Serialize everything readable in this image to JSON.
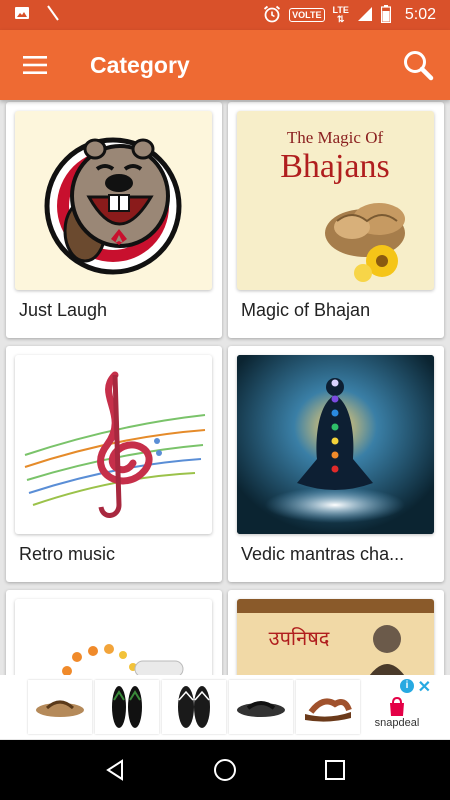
{
  "status_bar": {
    "time": "5:02",
    "volte": "VOLTE",
    "lte": "LTE",
    "icons": [
      "image-icon",
      "signal-slash-icon",
      "alarm-icon",
      "signal-icon",
      "battery-icon"
    ]
  },
  "app_bar": {
    "title": "Category",
    "menu_icon": "hamburger-menu-icon",
    "search_icon": "search-icon",
    "background": "#ee6a33",
    "status_background": "#d9512a"
  },
  "categories": [
    {
      "label": "Just Laugh",
      "image": "laughing-beaver-logo"
    },
    {
      "label": "Magic of Bhajan",
      "image": "magic-of-bhajans-cover",
      "image_text_top": "The Magic Of",
      "image_text_main": "Bhajans"
    },
    {
      "label": "Retro music",
      "image": "treble-clef-staff"
    },
    {
      "label": "Vedic mantras cha...",
      "image": "meditation-chakras"
    },
    {
      "label": "",
      "image": "flowers-scroll"
    },
    {
      "label": "",
      "image": "upanishad-scroll",
      "image_text": "उपनिषद"
    }
  ],
  "ad_banner": {
    "brand": "snapdeal",
    "info_label": "i",
    "close_label": "✕",
    "products": [
      "flip-flop-1",
      "flip-flop-2",
      "flip-flop-3",
      "flip-flop-4",
      "sandal-5"
    ]
  },
  "nav_bar": {
    "icons": [
      "back-icon",
      "home-icon",
      "recents-icon"
    ]
  }
}
